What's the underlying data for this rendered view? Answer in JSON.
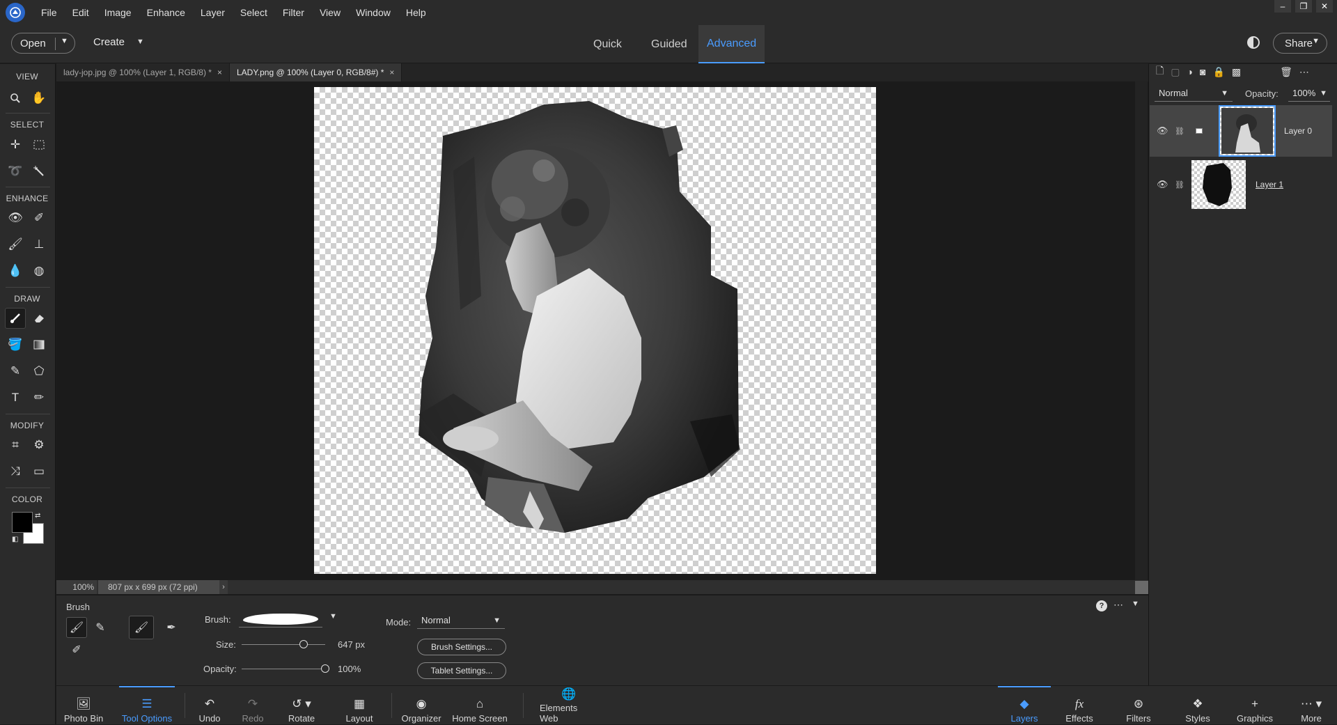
{
  "menu": [
    "File",
    "Edit",
    "Image",
    "Enhance",
    "Layer",
    "Select",
    "Filter",
    "View",
    "Window",
    "Help"
  ],
  "window_controls": {
    "minimize": "‒",
    "restore": "❐",
    "close": "✕"
  },
  "modebar": {
    "open_label": "Open",
    "create_label": "Create",
    "tabs": [
      {
        "label": "Quick"
      },
      {
        "label": "Guided"
      },
      {
        "label": "Advanced"
      }
    ],
    "active_tab": "Advanced",
    "share_label": "Share"
  },
  "toolbox": {
    "sections": [
      {
        "label": "VIEW"
      },
      {
        "label": "SELECT"
      },
      {
        "label": "ENHANCE"
      },
      {
        "label": "DRAW"
      },
      {
        "label": "MODIFY"
      },
      {
        "label": "COLOR"
      }
    ],
    "foreground_color": "#000000",
    "background_color": "#ffffff"
  },
  "doc_tabs": [
    {
      "label": "lady-jop.jpg @ 100% (Layer 1, RGB/8) *",
      "close": "×"
    },
    {
      "label": "LADY.png @ 100% (Layer 0, RGB/8#) *",
      "close": "×"
    }
  ],
  "status": {
    "zoom": "100%",
    "doc_size": "807 px x 699 px (72 ppi)",
    "more": "›"
  },
  "tool_options": {
    "tool_name": "Brush",
    "brush_label": "Brush:",
    "size_label": "Size:",
    "size_value": "647 px",
    "opacity_label": "Opacity:",
    "opacity_value": "100%",
    "mode_label": "Mode:",
    "mode_value": "Normal",
    "brush_settings_label": "Brush Settings...",
    "tablet_settings_label": "Tablet Settings...",
    "help": "?",
    "size_fraction": 0.74,
    "opacity_fraction": 1.0
  },
  "taskbar": [
    {
      "label": "Photo Bin"
    },
    {
      "label": "Tool Options"
    },
    {
      "label": "Undo"
    },
    {
      "label": "Redo"
    },
    {
      "label": "Rotate"
    },
    {
      "label": "Layout"
    },
    {
      "label": "Organizer"
    },
    {
      "label": "Home Screen"
    },
    {
      "label": "Elements Web"
    }
  ],
  "taskbar_right": [
    {
      "label": "Layers"
    },
    {
      "label": "Effects"
    },
    {
      "label": "Filters"
    },
    {
      "label": "Styles"
    },
    {
      "label": "Graphics"
    },
    {
      "label": "More"
    }
  ],
  "layers_panel": {
    "blend_mode": "Normal",
    "opacity_label": "Opacity:",
    "opacity_value": "100%",
    "layers": [
      {
        "name": "Layer 0",
        "selected": true
      },
      {
        "name": "Layer 1",
        "selected": false
      }
    ]
  },
  "colors": {
    "accent": "#4a9cff",
    "panel": "#2b2b2b",
    "canvas_bg": "#1b1b1b"
  }
}
